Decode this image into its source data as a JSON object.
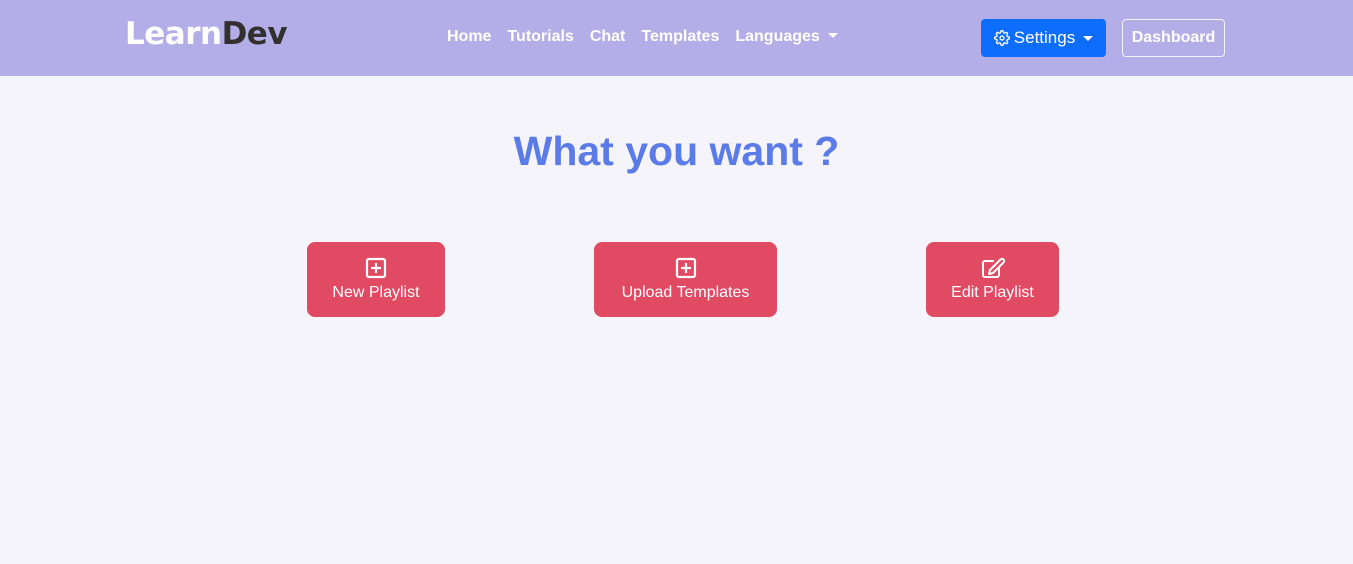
{
  "brand": {
    "part1": "Learn",
    "part2": "Dev"
  },
  "nav": {
    "links": [
      "Home",
      "Tutorials",
      "Chat",
      "Templates",
      "Languages"
    ]
  },
  "header": {
    "settings_label": "Settings",
    "dashboard_label": "Dashboard"
  },
  "main": {
    "title": "What you want ?",
    "actions": [
      {
        "label": "New Playlist",
        "icon": "plus-square-icon"
      },
      {
        "label": "Upload Templates",
        "icon": "plus-square-icon"
      },
      {
        "label": "Edit Playlist",
        "icon": "edit-icon"
      }
    ]
  },
  "colors": {
    "navbar": "#b3aee8",
    "background": "#f5f4fa",
    "primary": "#0d6efd",
    "heading": "#5b7be8",
    "action": "#e04a62"
  }
}
